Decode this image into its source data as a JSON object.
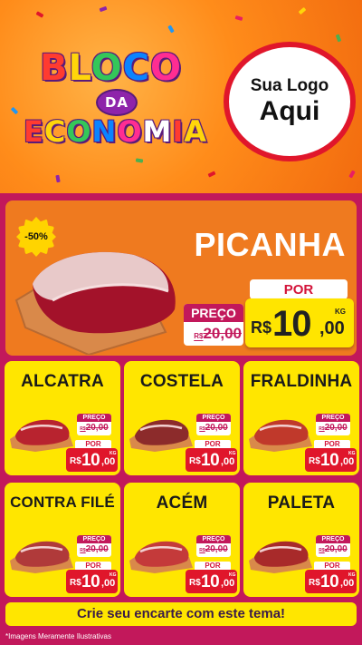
{
  "header": {
    "logo_top": "BLOCO",
    "logo_mid": "DA",
    "logo_bottom": "ECONOMIA",
    "logo_placeholder_line1": "Sua Logo",
    "logo_placeholder_line2": "Aqui"
  },
  "hero": {
    "discount_badge": "-50%",
    "name": "PICANHA",
    "preco_label": "PREÇO",
    "old_currency": "R$",
    "old_price": "20,00",
    "por_label": "POR",
    "currency": "R$",
    "price_int": "10",
    "price_cents": ",00",
    "unit": "KG"
  },
  "products": [
    {
      "name": "ALCATRA",
      "preco_label": "PREÇO",
      "old_currency": "R$",
      "old_price": "20,00",
      "por_label": "POR",
      "currency": "R$",
      "price_int": "10",
      "price_cents": ",00",
      "unit": "KG",
      "color": "#b8232f"
    },
    {
      "name": "COSTELA",
      "preco_label": "PREÇO",
      "old_currency": "R$",
      "old_price": "20,00",
      "por_label": "POR",
      "currency": "R$",
      "price_int": "10",
      "price_cents": ",00",
      "unit": "KG",
      "color": "#8c2b2b"
    },
    {
      "name": "FRALDINHA",
      "preco_label": "PREÇO",
      "old_currency": "R$",
      "old_price": "20,00",
      "por_label": "POR",
      "currency": "R$",
      "price_int": "10",
      "price_cents": ",00",
      "unit": "KG",
      "color": "#c0392b"
    },
    {
      "name": "CONTRA FILÉ",
      "preco_label": "PREÇO",
      "old_currency": "R$",
      "old_price": "20,00",
      "por_label": "POR",
      "currency": "R$",
      "price_int": "10",
      "price_cents": ",00",
      "unit": "KG",
      "color": "#b03a3a"
    },
    {
      "name": "ACÉM",
      "preco_label": "PREÇO",
      "old_currency": "R$",
      "old_price": "20,00",
      "por_label": "POR",
      "currency": "R$",
      "price_int": "10",
      "price_cents": ",00",
      "unit": "KG",
      "color": "#c43a3a"
    },
    {
      "name": "PALETA",
      "preco_label": "PREÇO",
      "old_currency": "R$",
      "old_price": "20,00",
      "por_label": "POR",
      "currency": "R$",
      "price_int": "10",
      "price_cents": ",00",
      "unit": "KG",
      "color": "#a82a2a"
    }
  ],
  "cta": "Crie seu encarte com este tema!",
  "footnote": "*Imagens Meramente Ilustrativas",
  "colors": {
    "header_orange": "#f26b0f",
    "hero_orange": "#ef7a1f",
    "card_yellow": "#ffe600",
    "price_red": "#e0162b",
    "background_magenta": "#c2185b"
  }
}
